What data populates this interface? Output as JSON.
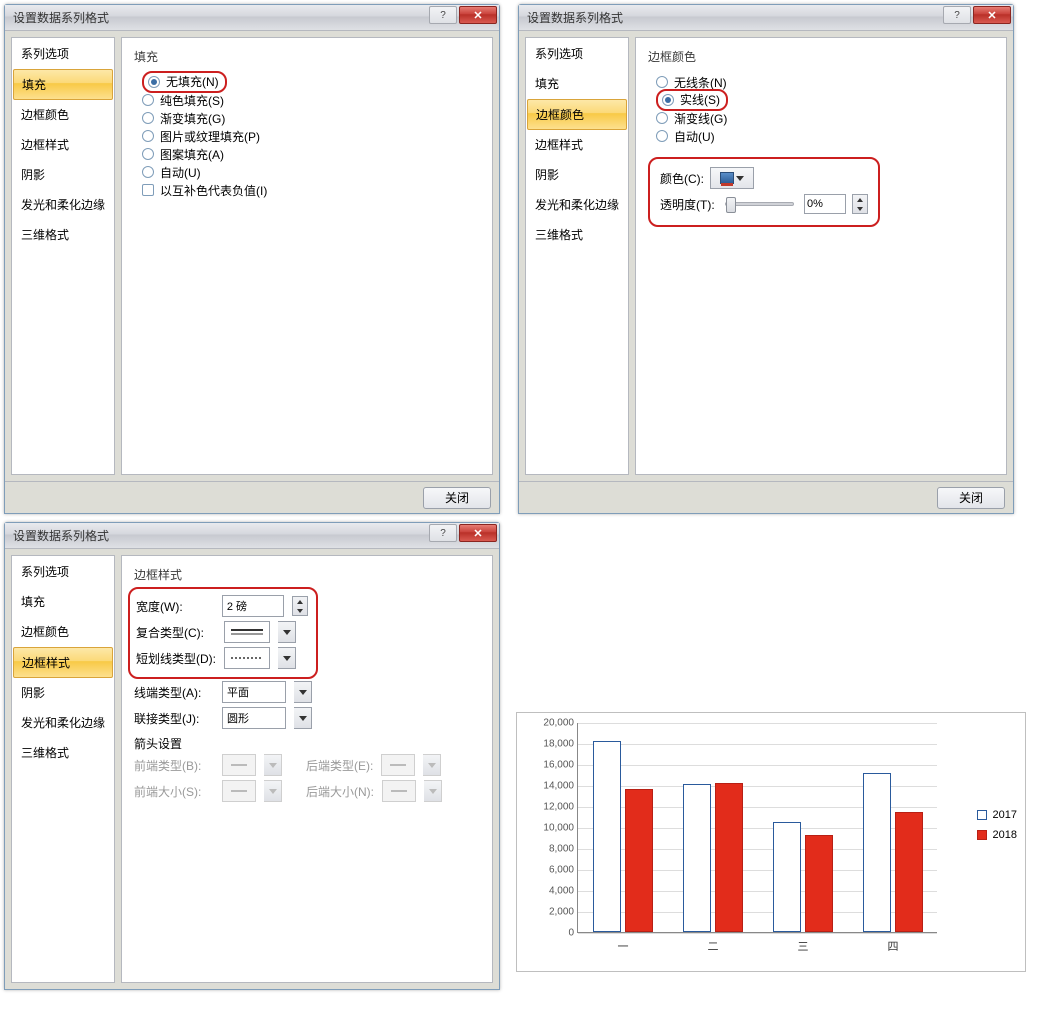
{
  "dialogs": {
    "title": "设置数据系列格式",
    "close_label": "关闭",
    "sidebar": [
      "系列选项",
      "填充",
      "边框颜色",
      "边框样式",
      "阴影",
      "发光和柔化边缘",
      "三维格式"
    ]
  },
  "fill": {
    "heading": "填充",
    "options": {
      "none": "无填充(N)",
      "solid": "纯色填充(S)",
      "gradient": "渐变填充(G)",
      "picture": "图片或纹理填充(P)",
      "pattern": "图案填充(A)",
      "auto": "自动(U)",
      "invert_negative": "以互补色代表负值(I)"
    }
  },
  "border_color": {
    "heading": "边框颜色",
    "options": {
      "none": "无线条(N)",
      "solid": "实线(S)",
      "gradient": "渐变线(G)",
      "auto": "自动(U)"
    },
    "color_label": "颜色(C):",
    "transparency_label": "透明度(T):",
    "transparency_value": "0%"
  },
  "border_style": {
    "heading": "边框样式",
    "width_label": "宽度(W):",
    "width_value": "2 磅",
    "compound_label": "复合类型(C):",
    "dash_label": "短划线类型(D):",
    "cap_label": "线端类型(A):",
    "cap_value": "平面",
    "join_label": "联接类型(J):",
    "join_value": "圆形",
    "arrow_heading": "箭头设置",
    "begin_type": "前端类型(B):",
    "end_type": "后端类型(E):",
    "begin_size": "前端大小(S):",
    "end_size": "后端大小(N):"
  },
  "chart_data": {
    "type": "bar",
    "categories": [
      "一",
      "二",
      "三",
      "四"
    ],
    "series": [
      {
        "name": "2017",
        "values": [
          18200,
          14100,
          10500,
          15100
        ]
      },
      {
        "name": "2018",
        "values": [
          13600,
          14200,
          9200,
          11400
        ]
      }
    ],
    "ylim": [
      0,
      20000
    ],
    "ystep": 2000,
    "ylabels": [
      "0",
      "2,000",
      "4,000",
      "6,000",
      "8,000",
      "10,000",
      "12,000",
      "14,000",
      "16,000",
      "18,000",
      "20,000"
    ]
  }
}
